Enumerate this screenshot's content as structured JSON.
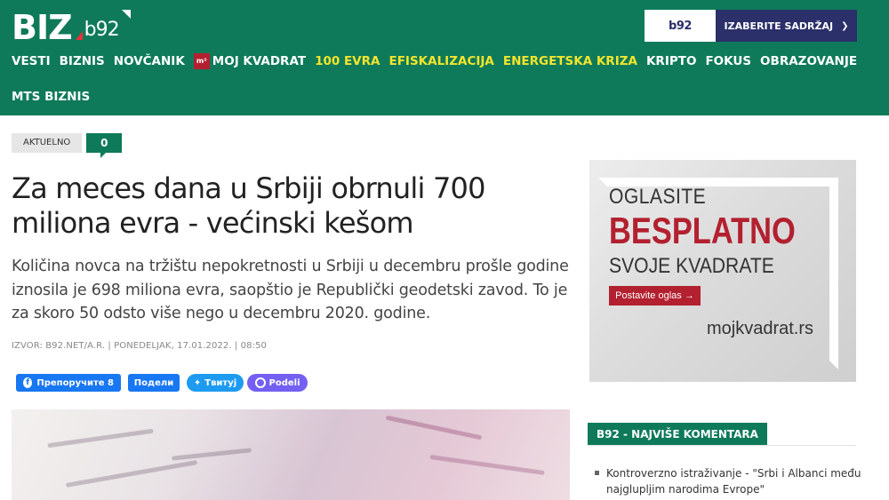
{
  "header": {
    "logo_text": "BIZ",
    "logo_sub": "b92",
    "b92_button": "b92",
    "select_label": "IZABERITE SADRŽAJ",
    "select_icon": "chevron-down-icon"
  },
  "nav": {
    "items": [
      {
        "label": "VESTI",
        "highlight": false
      },
      {
        "label": "BIZNIS",
        "highlight": false
      },
      {
        "label": "NOVČANIK",
        "highlight": false
      },
      {
        "label": "MOJ KVADRAT",
        "highlight": false,
        "badge": "m²"
      },
      {
        "label": "100 EVRA",
        "highlight": true
      },
      {
        "label": "EFISKALIZACIJA",
        "highlight": true
      },
      {
        "label": "ENERGETSKA KRIZA",
        "highlight": true
      },
      {
        "label": "KRIPTO",
        "highlight": false
      },
      {
        "label": "FOKUS",
        "highlight": false
      },
      {
        "label": "OBRAZOVANJE",
        "highlight": false
      }
    ],
    "row2": "MTS BIZNIS",
    "highlight_color": "#f4e52c"
  },
  "article": {
    "category": "AKTUELNO",
    "comment_count": "0",
    "title": "Za meces dana u Srbiji obrnuli 700 miliona evra - većinski kešom",
    "lead": "Količina novca na tržištu nepokretnosti u Srbiji u decembru prošle godine iznosila je 698 miliona evra, saopštio je Republički geodetski zavod. To je za skoro 50 odsto više nego u decembru 2020. godine.",
    "meta": "IZVOR: B92.NET/A.R. | PONEDELJAK, 17.01.2022. | 08:50"
  },
  "share": {
    "fb_like": "Препоручите 8",
    "fb_share": "Подели",
    "twitter": "Твитуј",
    "viber": "Podeli"
  },
  "ad": {
    "line1": "OGLASITE",
    "line2": "BESPLATNO",
    "line3": "SVOJE KVADRATE",
    "button": "Postavite oglas →",
    "url": "mojkvadrat.rs"
  },
  "widget": {
    "heading": "B92 - NAJVIŠE KOMENTARA",
    "items": [
      "Kontroverzno istraživanje - \"Srbi i Albanci među najglupljim narodima Evrope\""
    ]
  },
  "colors": {
    "brand_green": "#0e7a5a",
    "navy": "#2b2f6a",
    "ad_red": "#b3202f"
  }
}
